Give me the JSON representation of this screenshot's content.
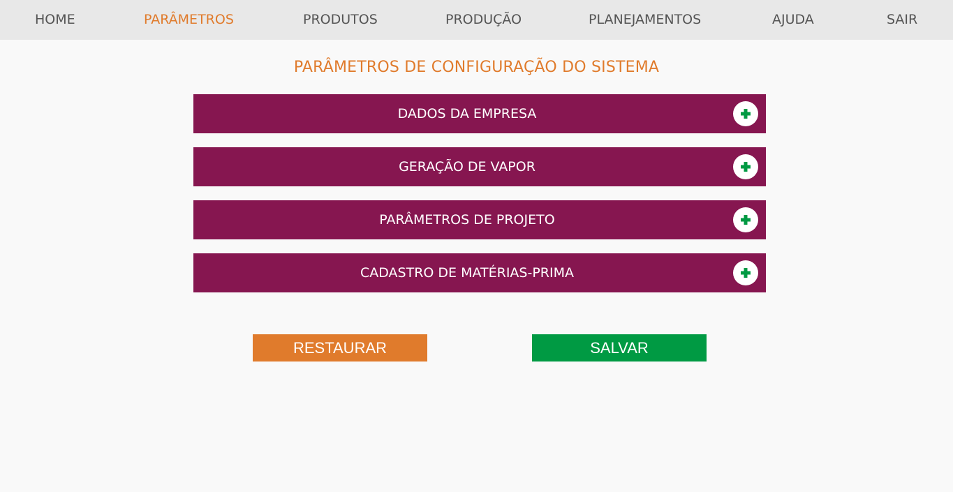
{
  "nav": {
    "items": [
      {
        "label": "HOME",
        "active": false
      },
      {
        "label": "PARÂMETROS",
        "active": true
      },
      {
        "label": "PRODUTOS",
        "active": false
      },
      {
        "label": "PRODUÇÃO",
        "active": false
      },
      {
        "label": "PLANEJAMENTOS",
        "active": false
      },
      {
        "label": "AJUDA",
        "active": false
      },
      {
        "label": "SAIR",
        "active": false
      }
    ]
  },
  "page": {
    "title": "PARÂMETROS DE CONFIGURAÇÃO DO SISTEMA"
  },
  "sections": [
    {
      "label": "DADOS DA EMPRESA",
      "icon": "plus-icon"
    },
    {
      "label": "GERAÇÃO DE VAPOR",
      "icon": "plus-icon"
    },
    {
      "label": "PARÂMETROS DE PROJETO",
      "icon": "plus-icon"
    },
    {
      "label": "CADASTRO DE MATÉRIAS-PRIMA",
      "icon": "plus-icon"
    }
  ],
  "actions": {
    "restore_label": "RESTAURAR",
    "save_label": "SALVAR"
  },
  "colors": {
    "accent": "#e07b2c",
    "section_bg": "#861650",
    "save": "#009a43",
    "nav_bg": "#e8e8e8",
    "nav_text": "#555555"
  }
}
